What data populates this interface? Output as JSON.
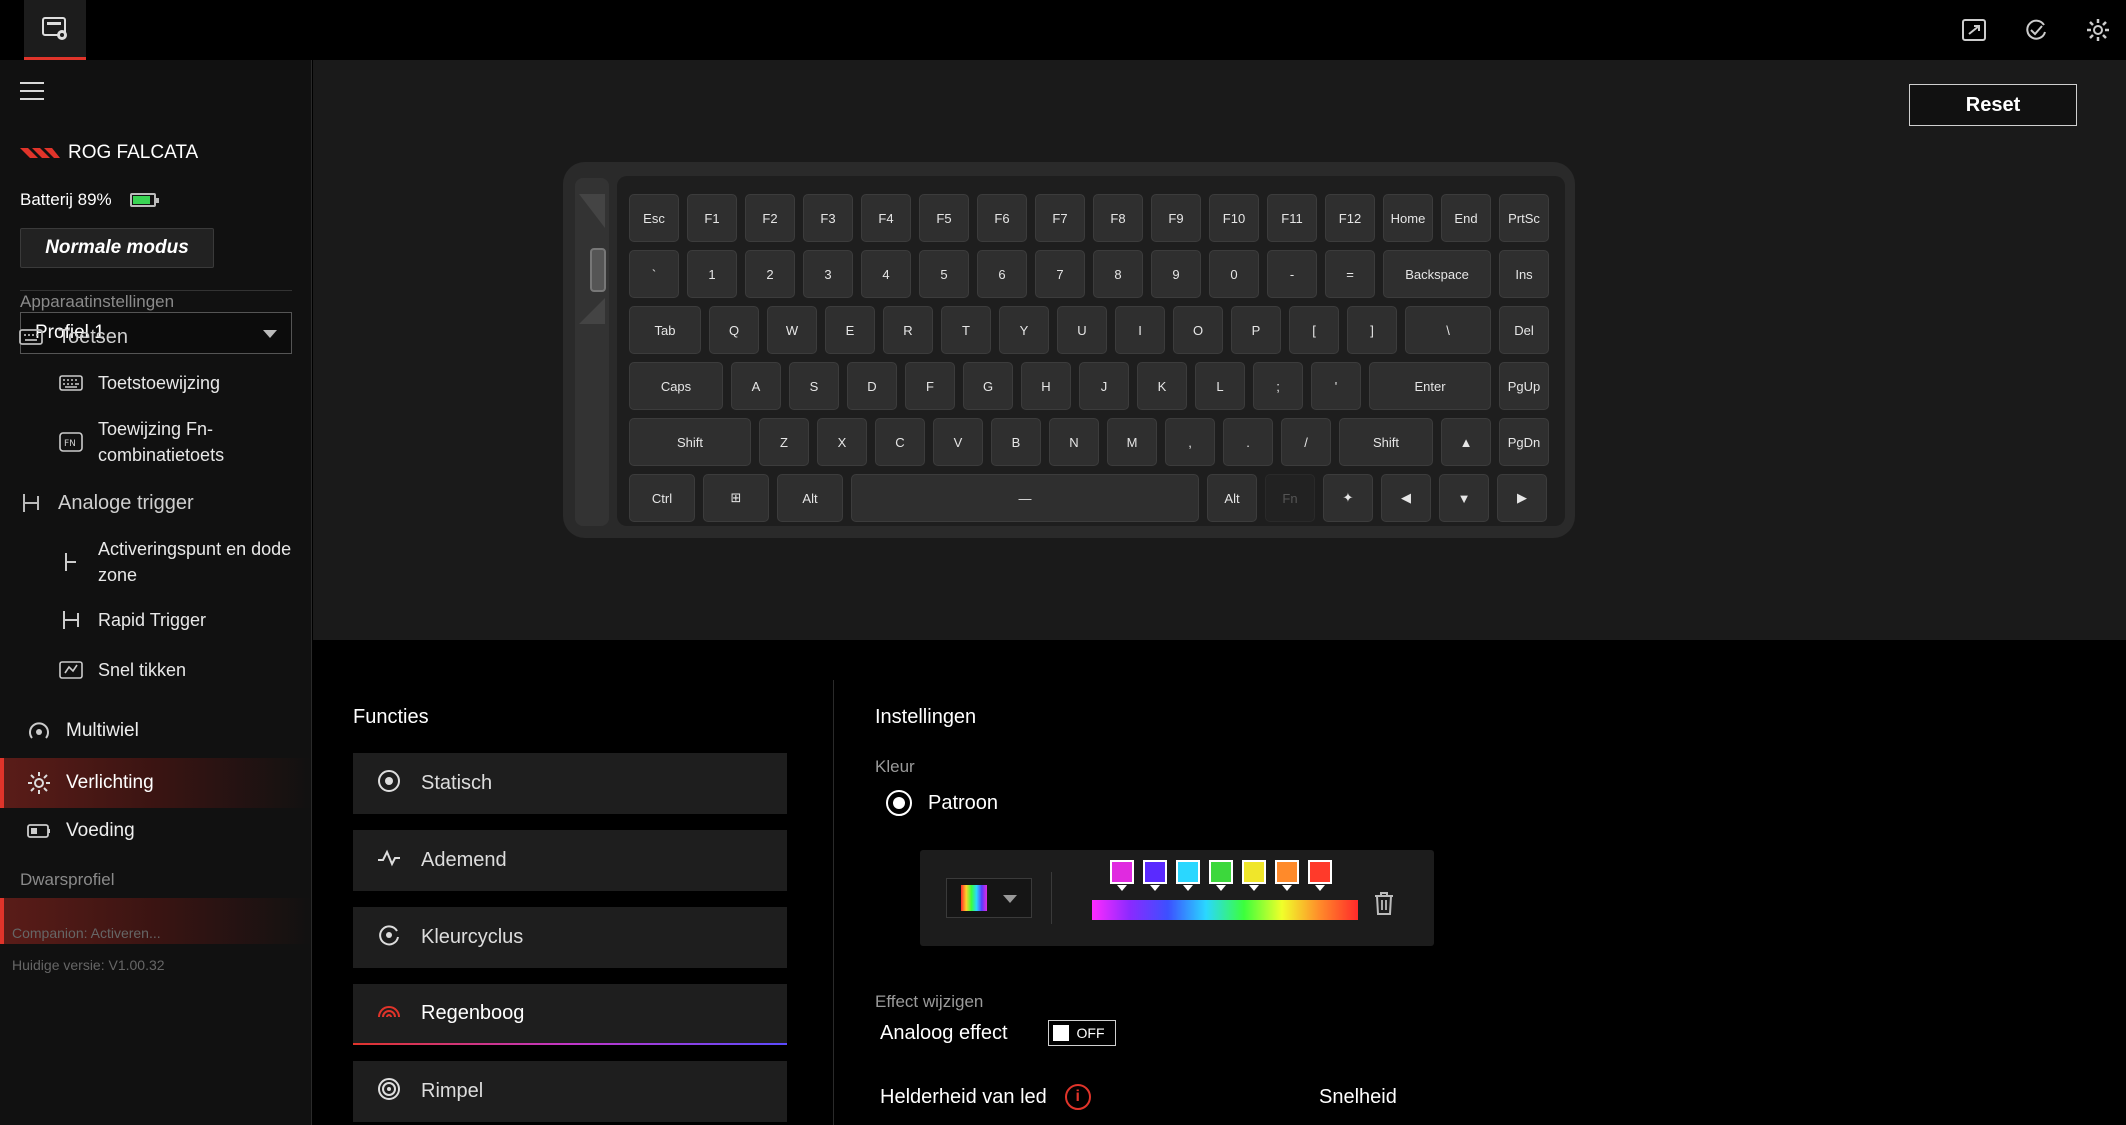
{
  "sidebar": {
    "device_name": "ROG FALCATA",
    "battery": "Batterij 89%",
    "battery_level": 0.89,
    "mode": "Normale modus",
    "profile": "Profiel 1",
    "section_device": "Apparaatinstellingen",
    "keys": "Toetsen",
    "key_assignment": "Toetstoewijzing",
    "fn_assignment": "Toewijzing Fn-combinatietoets",
    "analog_trigger": "Analoge trigger",
    "actuation": "Activeringspunt en dode zone",
    "rapid_trigger": "Rapid Trigger",
    "quick_tap": "Snel tikken",
    "multiwheel": "Multiwiel",
    "lighting": "Verlichting",
    "power": "Voeding",
    "section_cross": "Dwarsprofiel",
    "companion": "Companion: Activeren...",
    "version": "Huidige versie: V1.00.32"
  },
  "reset_label": "Reset",
  "keyboard": {
    "row1": [
      "Esc",
      "F1",
      "F2",
      "F3",
      "F4",
      "F5",
      "F6",
      "F7",
      "F8",
      "F9",
      "F10",
      "F11",
      "F12",
      "Home",
      "End",
      "PrtSc"
    ],
    "row2": [
      "`",
      "1",
      "2",
      "3",
      "4",
      "5",
      "6",
      "7",
      "8",
      "9",
      "0",
      "-",
      "=",
      "Backspace",
      "Ins"
    ],
    "row3": [
      "Tab",
      "Q",
      "W",
      "E",
      "R",
      "T",
      "Y",
      "U",
      "I",
      "O",
      "P",
      "[",
      "]",
      "\\",
      "Del"
    ],
    "row4": [
      "Caps",
      "A",
      "S",
      "D",
      "F",
      "G",
      "H",
      "J",
      "K",
      "L",
      ";",
      "'",
      "Enter",
      "PgUp"
    ],
    "row5": [
      "Shift",
      "Z",
      "X",
      "C",
      "V",
      "B",
      "N",
      "M",
      ",",
      ".",
      "/",
      "Shift",
      "▲",
      "PgDn"
    ],
    "row6": [
      "Ctrl",
      "⊞",
      "Alt",
      "—",
      "Alt",
      "Fn",
      "✦",
      "◀",
      "▼",
      "▶"
    ]
  },
  "functions": {
    "title": "Functies",
    "items": [
      "Statisch",
      "Ademend",
      "Kleurcyclus",
      "Regenboog",
      "Rimpel"
    ],
    "active": "Regenboog"
  },
  "settings": {
    "title": "Instellingen",
    "color_label": "Kleur",
    "pattern_label": "Patroon",
    "stops": [
      "#e02ae0",
      "#5a2aff",
      "#2ad7ff",
      "#3cd83c",
      "#f0e62a",
      "#ff8a2a",
      "#ff3a2a"
    ],
    "effect_label": "Effect wijzigen",
    "analog_label": "Analoog effect",
    "toggle_state": "OFF",
    "brightness_label": "Helderheid van led",
    "speed_label": "Snelheid"
  },
  "colors": {
    "accent": "#e0342a"
  }
}
